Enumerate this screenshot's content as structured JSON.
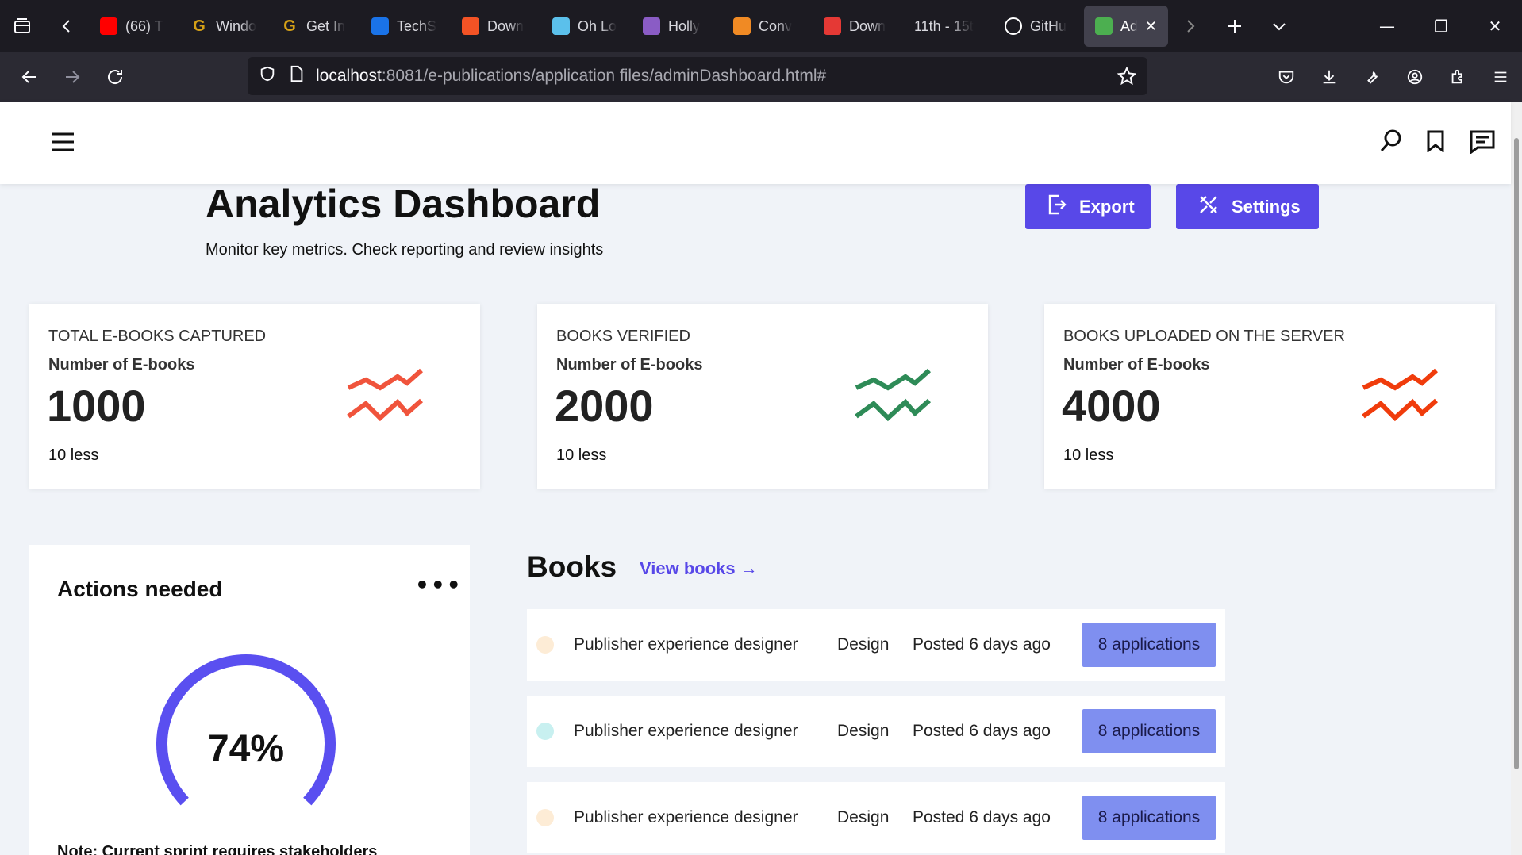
{
  "browser": {
    "tabs": [
      {
        "title": "(66) T",
        "icon": "youtube-icon",
        "color": "#ff0000"
      },
      {
        "title": "Windo",
        "icon": "g-icon",
        "color": "#d4a017"
      },
      {
        "title": "Get In",
        "icon": "g-icon",
        "color": "#d4a017"
      },
      {
        "title": "TechS",
        "icon": "triangle-icon",
        "color": "#1a73e8"
      },
      {
        "title": "Down",
        "icon": "windows-icon",
        "color": "#f35325"
      },
      {
        "title": "Oh Lo",
        "icon": "bitly-icon",
        "color": "#5bc0eb"
      },
      {
        "title": "Holly",
        "icon": "star-icon",
        "color": "#8a5cc5"
      },
      {
        "title": "Conv",
        "icon": "convert-icon",
        "color": "#f08a24"
      },
      {
        "title": "Down",
        "icon": "heart-icon",
        "color": "#e53935"
      },
      {
        "title": "11th - 15t",
        "icon": "",
        "color": ""
      },
      {
        "title": "GitHu",
        "icon": "github-icon",
        "color": "#ffffff"
      },
      {
        "title": "Ad",
        "icon": "app-icon",
        "color": "#4caf50",
        "active": true
      }
    ],
    "url_host": "localhost",
    "url_path": ":8081/e-publications/application files/adminDashboard.html#"
  },
  "page": {
    "title": "Analytics Dashboard",
    "subtitle": "Monitor key metrics. Check reporting and review insights",
    "export_label": "Export",
    "settings_label": "Settings"
  },
  "cards": [
    {
      "title": "TOTAL E-BOOKS CAPTURED",
      "subtitle": "Number of E-books",
      "value": "1000",
      "note": "10 less",
      "color": "#f0543c"
    },
    {
      "title": "BOOKS VERIFIED",
      "subtitle": "Number of E-books",
      "value": "2000",
      "note": "10 less",
      "color": "#2e8b57"
    },
    {
      "title": "BOOKS UPLOADED ON THE SERVER",
      "subtitle": "Number of E-books",
      "value": "4000",
      "note": "10 less",
      "color": "#f03c0c"
    }
  ],
  "actions": {
    "title": "Actions needed",
    "percent": "74%",
    "progress": 0.74,
    "note": "Note: Current sprint requires stakeholders"
  },
  "books": {
    "title": "Books",
    "view_label": "View books →",
    "rows": [
      {
        "role": "Publisher experience designer",
        "category": "Design",
        "posted": "Posted 6 days ago",
        "applications": "8 applications",
        "dot_color": "#fdecd6"
      },
      {
        "role": "Publisher experience designer",
        "category": "Design",
        "posted": "Posted 6 days ago",
        "applications": "8 applications",
        "dot_color": "#c8f0f0"
      },
      {
        "role": "Publisher experience designer",
        "category": "Design",
        "posted": "Posted 6 days ago",
        "applications": "8 applications",
        "dot_color": "#fdecd6"
      }
    ]
  },
  "colors": {
    "accent": "#5848e8",
    "badge": "#7f8ff0"
  }
}
